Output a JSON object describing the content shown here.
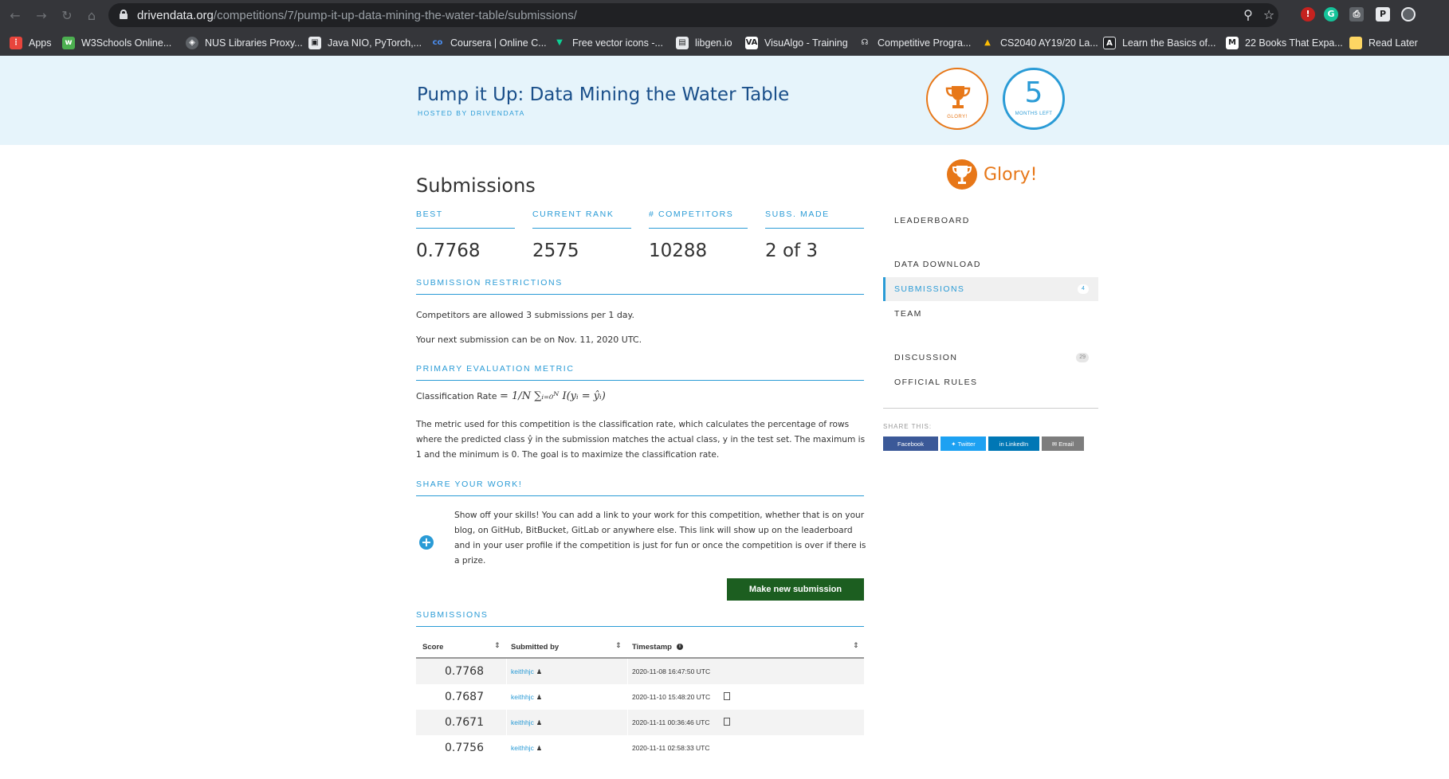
{
  "browser": {
    "url_host": "drivendata.org",
    "url_path": "/competitions/7/pump-it-up-data-mining-the-water-table/submissions/",
    "bookmarks": [
      {
        "label": "Apps",
        "icon": "apps-grid-icon",
        "color": "#e8453c"
      },
      {
        "label": "W3Schools Online...",
        "icon": "w3schools-icon",
        "color": "#4caf50"
      },
      {
        "label": "NUS Libraries Proxy...",
        "icon": "globe-icon",
        "color": "#9aa0a6"
      },
      {
        "label": "Java NIO, PyTorch,...",
        "icon": "site-icon",
        "color": "#e8eaed"
      },
      {
        "label": "Coursera | Online C...",
        "icon": "coursera-icon",
        "color": "#2a73cc"
      },
      {
        "label": "Free vector icons -...",
        "icon": "flaticon-icon",
        "color": "#0ed095"
      },
      {
        "label": "libgen.io",
        "icon": "book-icon",
        "color": "#e8eaed"
      },
      {
        "label": "VisuAlgo - Training",
        "icon": "visualgo-icon",
        "color": "#ffffff"
      },
      {
        "label": "Competitive Progra...",
        "icon": "headphones-icon",
        "color": "#e8eaed"
      },
      {
        "label": "CS2040 AY19/20 La...",
        "icon": "google-drive-icon",
        "color": "#fbbc04"
      },
      {
        "label": "Learn the Basics of...",
        "icon": "angular-icon",
        "color": "#e8eaed"
      },
      {
        "label": "22 Books That Expa...",
        "icon": "medium-icon",
        "color": "#ffffff"
      },
      {
        "label": "Read Later",
        "icon": "folder-icon",
        "color": "#fdd663"
      }
    ]
  },
  "header": {
    "title": "Pump it Up: Data Mining the Water Table",
    "hosted_by": "HOSTED BY DRIVENDATA",
    "prize_label": "GLORY!",
    "months_left_number": "5",
    "months_left_label": "MONTHS LEFT"
  },
  "main": {
    "heading": "Submissions",
    "stats": [
      {
        "key": "BEST",
        "value": "0.7768"
      },
      {
        "key": "CURRENT RANK",
        "value": "2575"
      },
      {
        "key": "# COMPETITORS",
        "value": "10288"
      },
      {
        "key": "SUBS. MADE",
        "value": "2 of 3"
      }
    ],
    "restrictions": {
      "heading": "SUBMISSION RESTRICTIONS",
      "line1": "Competitors are allowed 3 submissions per 1 day.",
      "line2": "Your next submission can be on Nov. 11, 2020 UTC."
    },
    "metric": {
      "heading": "PRIMARY EVALUATION METRIC",
      "formula_label": "Classification Rate",
      "formula": "= 1/N ∑ᵢ₌₀ᴺ I(yᵢ = ŷᵢ)",
      "description": "The metric used for this competition is the classification rate, which calculates the percentage of rows where the predicted class ŷ in the submission matches the actual class, y in the test set. The maximum is 1 and the minimum is 0. The goal is to maximize the classification rate."
    },
    "share_work": {
      "heading": "SHARE YOUR WORK!",
      "text": "Show off your skills! You can add a link to your work for this competition, whether that is on your blog, on GitHub, BitBucket, GitLab or anywhere else. This link will show up on the leaderboard and in your user profile if the competition is just for fun or once the competition is over if there is a prize."
    },
    "make_submission_label": "Make new submission",
    "submissions": {
      "heading": "SUBMISSIONS",
      "columns": [
        "Score",
        "Submitted by",
        "Timestamp"
      ],
      "rows": [
        {
          "score": "0.7768",
          "user": "keithhjc",
          "timestamp": "2020-11-08 16:47:50 UTC",
          "has_doc": false
        },
        {
          "score": "0.7687",
          "user": "keithhjc",
          "timestamp": "2020-11-10 15:48:20 UTC",
          "has_doc": true
        },
        {
          "score": "0.7671",
          "user": "keithhjc",
          "timestamp": "2020-11-11 00:36:46 UTC",
          "has_doc": true
        },
        {
          "score": "0.7756",
          "user": "keithhjc",
          "timestamp": "2020-11-11 02:58:33 UTC",
          "has_doc": false
        }
      ]
    }
  },
  "sidebar": {
    "prize": "Glory!",
    "nav": [
      {
        "label": "LEADERBOARD",
        "count": ""
      },
      {
        "label": "DATA DOWNLOAD",
        "count": ""
      },
      {
        "label": "SUBMISSIONS",
        "count": "4"
      },
      {
        "label": "TEAM",
        "count": ""
      },
      {
        "label": "DISCUSSION",
        "count": "29"
      },
      {
        "label": "OFFICIAL RULES",
        "count": ""
      }
    ],
    "share_label": "SHARE THIS:",
    "share_buttons": [
      {
        "label": "Facebook",
        "icon": "facebook-icon",
        "color": "#3b5998"
      },
      {
        "label": "Twitter",
        "icon": "twitter-icon",
        "color": "#1da1f2"
      },
      {
        "label": "LinkedIn",
        "icon": "linkedin-icon",
        "color": "#0077b5"
      },
      {
        "label": "Email",
        "icon": "email-icon",
        "color": "#7d7d7d"
      }
    ]
  },
  "colors": {
    "accent": "#2a9bd6",
    "brand_title": "#1a4f8a",
    "prize_orange": "#e77718",
    "submit_green": "#1c5e20",
    "hero_bg": "#e6f4fb"
  }
}
